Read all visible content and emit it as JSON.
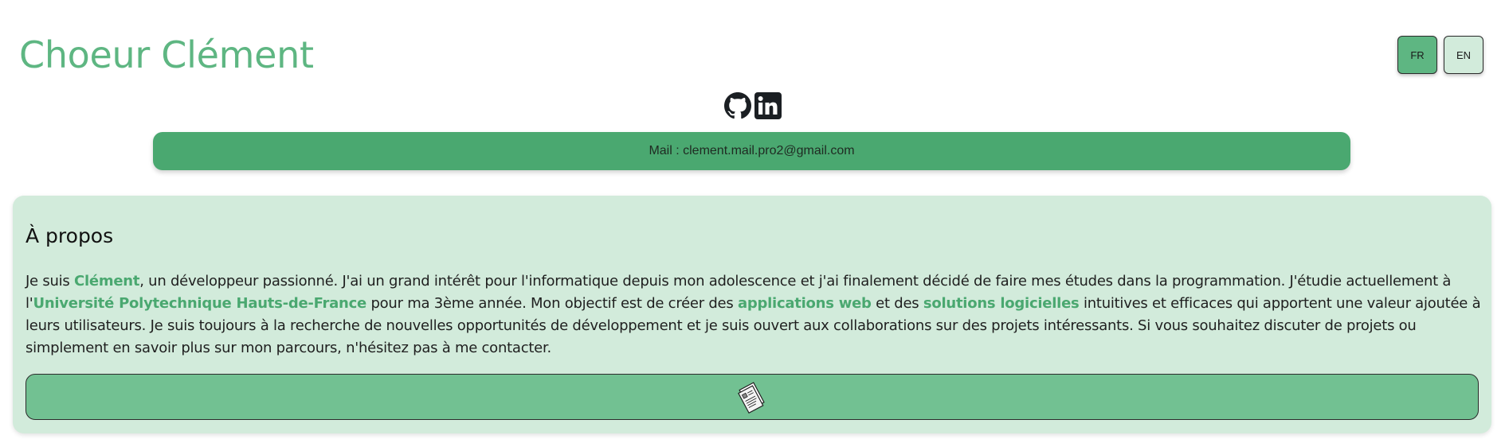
{
  "header": {
    "title": "Choeur Clément"
  },
  "lang": {
    "fr": "FR",
    "en": "EN",
    "selected": "FR"
  },
  "social": {
    "icons": [
      "github-icon",
      "linkedin-icon"
    ]
  },
  "contact": {
    "mail_label": "Mail : clement.mail.pro2@gmail.com"
  },
  "about": {
    "heading": "À propos",
    "p1": "Je suis ",
    "name": "Clément",
    "p2": ", un développeur passionné. J'ai un grand intérêt pour l'informatique depuis mon adolescence et j'ai finalement décidé de faire mes études dans la programmation. J'étudie actuellement à l'",
    "university": "Université Polytechnique Hauts-de-France",
    "p3": " pour ma 3ème année. Mon objectif est de créer des ",
    "webapps": "applications web",
    "p4": " et des ",
    "software": "solutions logicielles",
    "p5": " intuitives et efficaces qui apportent une valeur ajoutée à leurs utilisateurs. Je suis toujours à la recherche de nouvelles opportunités de développement et je suis ouvert aux collaborations sur des projets intéressants. Si vous souhaitez discuter de projets ou simplement en savoir plus sur mon parcours, n'hésitez pas à me contacter.",
    "cv_icon": "document-icon"
  },
  "colors": {
    "accent": "#5eb682",
    "bar": "#4aa870",
    "panel": "#d2ebdb",
    "button": "#72c192"
  }
}
